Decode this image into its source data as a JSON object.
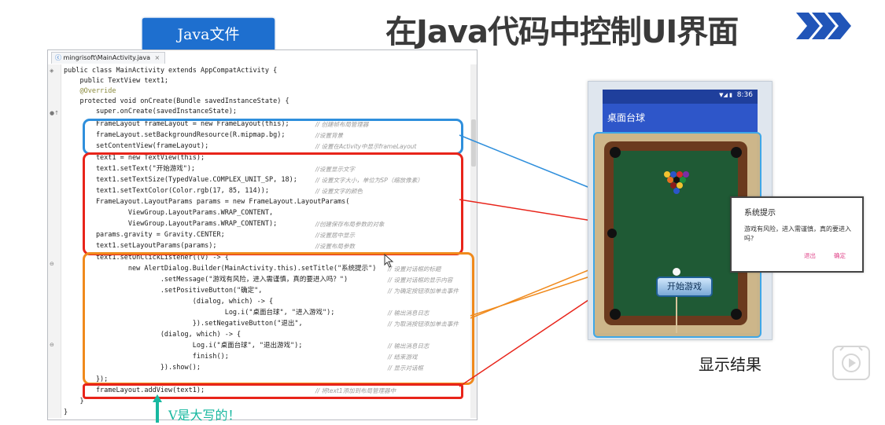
{
  "slide": {
    "title": "在Java代码中控制UI界面",
    "callout": "Java文件",
    "result_label": "显示结果",
    "note": "V是大写的！"
  },
  "editor": {
    "tab_label": "mingrisoft\\MainActivity.java",
    "tab_close": "×",
    "lines": [
      "public class MainActivity extends AppCompatActivity {",
      "    public TextView text1;",
      "    @Override",
      "    protected void onCreate(Bundle savedInstanceState) {",
      "        super.onCreate(savedInstanceState);",
      "        FrameLayout frameLayout = new FrameLayout(this);",
      "        frameLayout.setBackgroundResource(R.mipmap.bg);",
      "        setContentView(frameLayout);",
      "        text1 = new TextView(this);",
      "        text1.setText(\"开始游戏\");",
      "        text1.setTextSize(TypedValue.COMPLEX_UNIT_SP, 18);",
      "        text1.setTextColor(Color.rgb(17, 85, 114));",
      "        FrameLayout.LayoutParams params = new FrameLayout.LayoutParams(",
      "                ViewGroup.LayoutParams.WRAP_CONTENT,",
      "                ViewGroup.LayoutParams.WRAP_CONTENT);",
      "        params.gravity = Gravity.CENTER;",
      "        text1.setLayoutParams(params);",
      "        text1.setOnClickListener((v) -> {",
      "                new AlertDialog.Builder(MainActivity.this).setTitle(\"系统提示\")",
      "                        .setMessage(\"游戏有风险，进入需谨慎，真的要进入吗？\")",
      "                        .setPositiveButton(\"确定\",",
      "                                (dialog, which) -> {",
      "                                        Log.i(\"桌面台球\", \"进入游戏\");",
      "                                }).setNegativeButton(\"退出\",",
      "                        (dialog, which) -> {",
      "                                Log.i(\"桌面台球\", \"退出游戏\");",
      "                                finish();",
      "                        }).show();",
      "        });",
      "        frameLayout.addView(text1);",
      "    }",
      "}"
    ],
    "comments": {
      "c5": "// 创建帧布局管理器",
      "c6": "//设置背景",
      "c7": "// 设置在Activity中显示frameLayout",
      "c9": "//设置显示文字",
      "c10": "// 设置文字大小，单位为SP（缩放像素）",
      "c11": "// 设置文字的颜色",
      "c14": "//创建保存布局参数的对象",
      "c15": "//设置居中显示",
      "c16": "//设置布局参数",
      "c18": "// 设置对话框的标题",
      "c19": "// 设置对话框的显示内容",
      "c20": "// 为确定按钮添加单击事件",
      "c22": "// 输出消息日志",
      "c23": "// 为取消按钮添加单击事件",
      "c25": "// 输出消息日志",
      "c26": "// 结束游戏",
      "c27": "// 显示对话框",
      "c29": "// 将text1添加到布局管理器中"
    }
  },
  "phone": {
    "status_time": "8:36",
    "status_icons": "▼◢ ▮",
    "app_title": "桌面台球",
    "button_text": "开始游戏"
  },
  "dialog": {
    "title": "系统提示",
    "message": "游戏有风险，进入需谨慎，真的要进入吗?",
    "negative": "退出",
    "positive": "确定"
  },
  "colors": {
    "blue_box": "#2f8fdc",
    "red_box": "#e8241a",
    "orange_box": "#f08a1c",
    "callout": "#1e6fcf",
    "title": "#3a3a3a",
    "chevrons": "#2155b8"
  }
}
